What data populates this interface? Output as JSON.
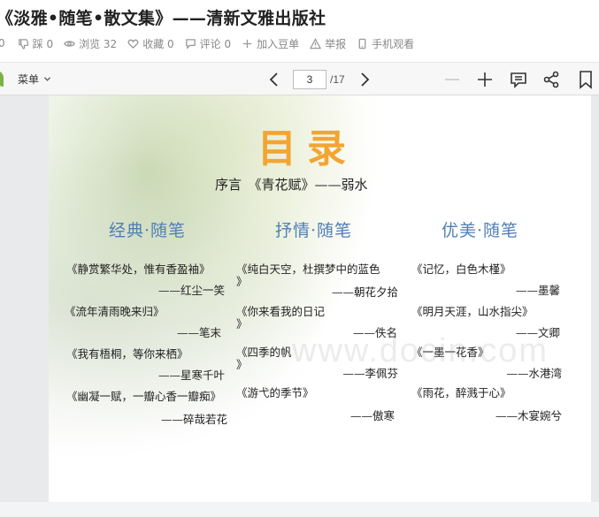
{
  "header": {
    "title": "《淡雅•随笔•散文集》——清新文雅出版社",
    "stats": {
      "first": "0",
      "dislike": "踩 0",
      "views": "浏览 32",
      "favorite": "收藏 0",
      "comment": "评论 0",
      "add_to_list": "加入豆单",
      "report": "举报",
      "mobile": "手机观看"
    }
  },
  "toolbar": {
    "menu_label": "菜单",
    "page_current": "3",
    "page_total": "/17"
  },
  "document": {
    "toc_title": "目录",
    "preface": "序言　《青花赋》——弱水",
    "watermark": "www.docin.com",
    "categories": [
      "经典·随笔",
      "抒情·随笔",
      "优美·随笔"
    ],
    "col1": [
      {
        "title": "《静赏繁华处，惟有香盈袖》",
        "author": "——红尘一笑"
      },
      {
        "title": "《流年清雨晚来归》",
        "author": "——笔末"
      },
      {
        "title": "《我有梧桐，等你来栖》",
        "author": "——星寒千叶"
      },
      {
        "title": "《幽凝一赋，一瓣心香一瓣痴》",
        "author": "——碎哉若花"
      }
    ],
    "col2": [
      {
        "title": "《纯白天空，杜撰梦中的蓝色",
        "title2": "》",
        "author": "——朝花夕拾"
      },
      {
        "title": "《你来看我的日记",
        "title2": "》",
        "author": "——佚名"
      },
      {
        "title": "《四季的帆",
        "title2": "》",
        "author": "——李佩芬"
      },
      {
        "title": "《游弋的季节》",
        "author": "——傲寒"
      }
    ],
    "col3": [
      {
        "title": "《记忆，白色木槿》",
        "author": "——墨馨"
      },
      {
        "title": "《明月天涯，山水指尖》",
        "author": "——文卿"
      },
      {
        "title": "《一墨一花香》",
        "author": "——水港湾"
      },
      {
        "title": "《雨花，醉溅于心》",
        "author": "——木宴婉兮"
      }
    ]
  },
  "colors": {
    "title_orange": "#f2a531",
    "category_blue": "#4f7fb8"
  }
}
